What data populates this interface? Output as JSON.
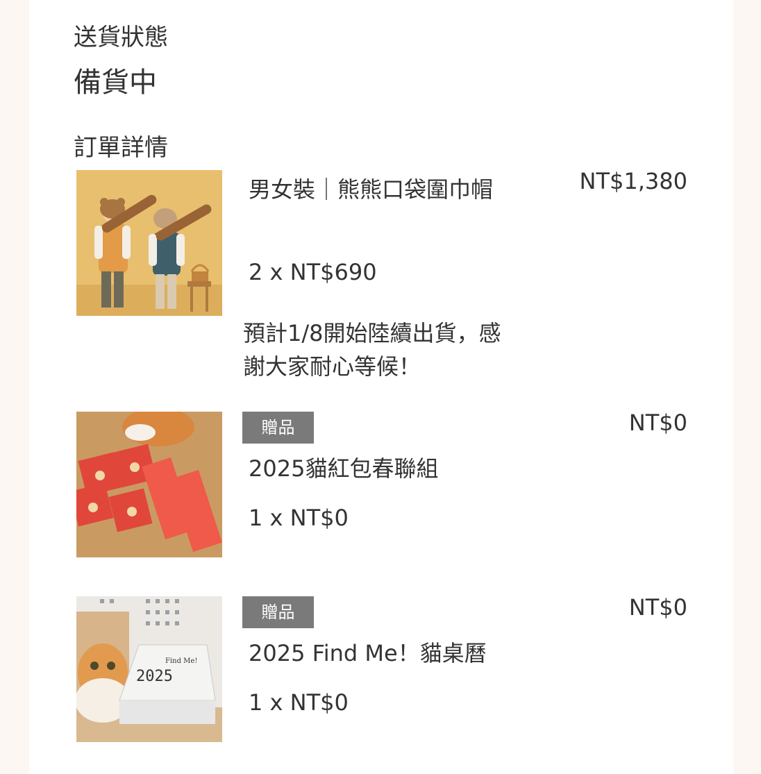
{
  "shipping": {
    "label": "送貨狀態",
    "status": "備貨中"
  },
  "order": {
    "label": "訂單詳情",
    "items": [
      {
        "image_icon": "product-photo-hooded-scarf",
        "name": "男女裝｜熊熊口袋圍巾帽",
        "quantity": "2 x NT$690",
        "price": "NT$1,380",
        "note": "預計1/8開始陸續出貨，感謝大家耐心等候！"
      },
      {
        "image_icon": "product-photo-red-envelopes",
        "badge": "贈品",
        "name": "2025貓紅包春聯組",
        "quantity": "1 x NT$0",
        "price": "NT$0"
      },
      {
        "image_icon": "product-photo-desk-calendar",
        "badge": "贈品",
        "name": "2025 Find Me！貓桌曆",
        "quantity": "1 x NT$0",
        "price": "NT$0"
      }
    ]
  },
  "colors": {
    "page_background": "#fdf7f3",
    "panel_background": "#ffffff",
    "text": "#333333",
    "badge_background": "#7a7a7a",
    "badge_text": "#ffffff"
  }
}
